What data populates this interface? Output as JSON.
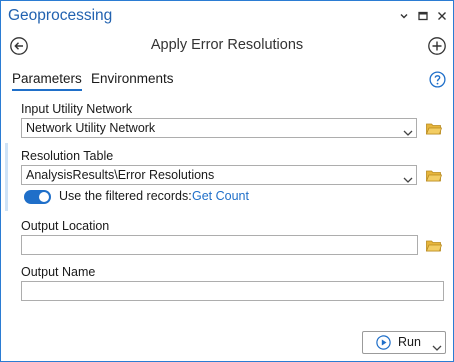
{
  "pane": {
    "title": "Geoprocessing",
    "controls": [
      "chevron-down-icon",
      "restore-icon",
      "close-icon"
    ]
  },
  "tool": {
    "title": "Apply Error Resolutions",
    "back_icon": "back-arrow-icon",
    "add_icon": "add-icon"
  },
  "tabs": [
    {
      "label": "Parameters",
      "active": true
    },
    {
      "label": "Environments",
      "active": false
    }
  ],
  "help_icon": "help-icon",
  "params": {
    "input_network": {
      "label": "Input Utility Network",
      "value": "Network Utility Network"
    },
    "resolution_table": {
      "label": "Resolution Table",
      "value": "AnalysisResults\\Error Resolutions"
    },
    "filtered": {
      "label": "Use the filtered records:",
      "enabled": true,
      "link": "Get Count"
    },
    "output_location": {
      "label": "Output Location",
      "value": ""
    },
    "output_name": {
      "label": "Output Name",
      "value": ""
    }
  },
  "run": {
    "label": "Run"
  },
  "colors": {
    "accent": "#1f6fc9",
    "title": "#2262b0",
    "folder": "#e6b53c",
    "border": "#2b7cd3"
  }
}
